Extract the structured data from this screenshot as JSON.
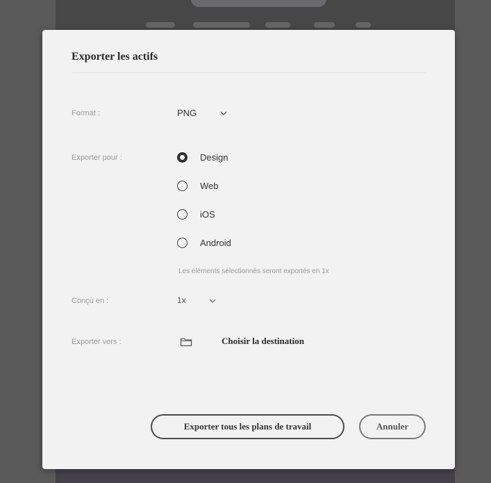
{
  "dialog": {
    "title": "Exporter les actifs",
    "format": {
      "label": "Format :",
      "value": "PNG"
    },
    "export_for": {
      "label": "Exporter pour :",
      "options": [
        {
          "label": "Design",
          "selected": true
        },
        {
          "label": "Web",
          "selected": false
        },
        {
          "label": "iOS",
          "selected": false
        },
        {
          "label": "Android",
          "selected": false
        }
      ],
      "hint": "Les éléments sélectionnés seront exportés en 1x"
    },
    "designed_in": {
      "label": "Conçu en :",
      "value": "1x"
    },
    "export_to": {
      "label": "Exporter vers :",
      "destination": "Choisir la destination",
      "icon": "folder-icon"
    },
    "buttons": {
      "export_all": "Exporter tous les plans de travail",
      "cancel": "Annuler"
    }
  }
}
